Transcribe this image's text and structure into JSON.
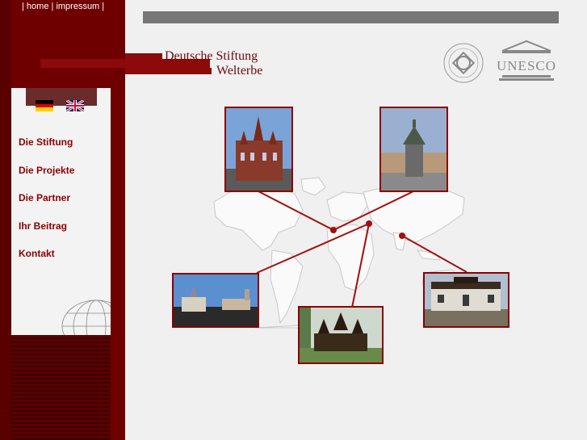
{
  "topnav": {
    "sep1": "|",
    "home": "home",
    "sep2": "|",
    "impressum": "impressum",
    "sep3": "|"
  },
  "header": {
    "title_line1": "Deutsche Stiftung",
    "title_line2": "Welterbe"
  },
  "languages": [
    "german-flag",
    "british-flag"
  ],
  "nav": {
    "items": [
      "Die Stiftung",
      "Die Projekte",
      "Die Partner",
      "Ihr Beitrag",
      "Kontakt"
    ]
  },
  "logos": {
    "unesco": "UNESCO"
  },
  "colors": {
    "sidebar": "#6e0000",
    "accent": "#8b0000",
    "background": "#f1f0f1",
    "topbar": "#777777"
  }
}
